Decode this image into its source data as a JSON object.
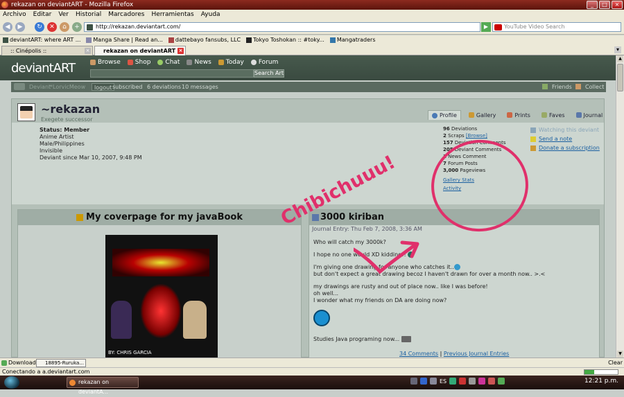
{
  "window": {
    "title": "rekazan on deviantART - Mozilla Firefox"
  },
  "menu": [
    "Archivo",
    "Editar",
    "Ver",
    "Historial",
    "Marcadores",
    "Herramientas",
    "Ayuda"
  ],
  "nav": {
    "url": "http://rekazan.deviantart.com/",
    "search_placeholder": "YouTube Video Search"
  },
  "bookmarks": [
    "deviantART: where ART ...",
    "Manga Share | Read an...",
    "dattebayo fansubs, LLC",
    "Tokyo Toshokan :: #toky...",
    "Mangatraders"
  ],
  "tabs": [
    ":: Cinépolis ::",
    "rekazan on deviantART"
  ],
  "da": {
    "logo": "deviantART",
    "nav": [
      "Browse",
      "Shop",
      "Chat",
      "News",
      "Today",
      "Forum"
    ],
    "search_button": "Search Art",
    "subbar": {
      "deviant": "Deviant",
      "username": "*LorvicMeow",
      "logout": "logout",
      "subscribed": "subscribed",
      "deviations": "6 deviations",
      "messages": "10 messages",
      "friends": "Friends",
      "collect": "Collect"
    }
  },
  "profile": {
    "username": "~rekazan",
    "tagline": "Exegete successor",
    "tabs": [
      "Profile",
      "Gallery",
      "Prints",
      "Faves",
      "Journal"
    ],
    "status_label": "Status: Member",
    "details": [
      "Anime Artist",
      "Male/Philippines",
      "Invisible",
      "Deviant since Mar 10, 2007, 9:48 PM"
    ],
    "stats": [
      {
        "num": "96",
        "label": "Deviations"
      },
      {
        "num": "2",
        "label": "Scraps",
        "extra": "[Browse]"
      },
      {
        "num": "157",
        "label": "Deviation Comments"
      },
      {
        "num": "205",
        "label": "Deviant Comments"
      },
      {
        "num": "1",
        "label": "News Comment"
      },
      {
        "num": "7",
        "label": "Forum Posts"
      },
      {
        "num": "3,000",
        "label": "Pageviews"
      }
    ],
    "stats_links": [
      "Gallery Stats",
      "Activity"
    ],
    "actions": [
      "Watching this deviant",
      "Send a note",
      "Donate a subscription"
    ]
  },
  "left_box": {
    "title": "My coverpage for my javaBook",
    "credit": "BY: CHRIS GARCIA"
  },
  "journal": {
    "title": "3000 kiriban",
    "date": "Journal Entry: Thu Feb 7, 2008, 3:36 AM",
    "lines": [
      "Who will catch my 3000k?",
      "I hope no one would XD kidding!!",
      "I'm giving one drawing for anyone who catches it..",
      "but don't expect a great drawing becoz I haven't drawn for over a month now.. >.<",
      "my drawings are rusty and out of place now.. like I was before!",
      "oh well...",
      "I wonder what my friends on DA are doing now?",
      "Studies Java programing now..."
    ],
    "comments": "34 Comments",
    "separator": "|",
    "prev": "Previous Journal Entries"
  },
  "annotation": {
    "text": "Chibichuuu!",
    "color": "#e0306b"
  },
  "downloads": {
    "label": "Downloads",
    "item": "18895-Ruruka...",
    "clear": "Clear"
  },
  "status": {
    "text": "Conectando a a.deviantart.com",
    "progress": 0.3
  },
  "taskbar": {
    "window": "rekazan on deviantA...",
    "lang": "ES",
    "time": "12:21 p.m."
  }
}
